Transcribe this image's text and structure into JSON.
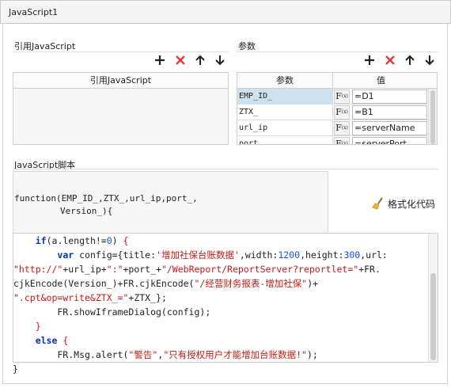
{
  "window": {
    "title": "JavaScript1"
  },
  "ref_section": {
    "label": "引用JavaScript",
    "column_header": "引用JavaScript",
    "rows": []
  },
  "params_section": {
    "label": "参数",
    "headers": {
      "name": "参数",
      "value": "值"
    },
    "rows": [
      {
        "name": "EMP_ID_",
        "value": "=D1",
        "selected": true
      },
      {
        "name": "ZTX_",
        "value": "=B1",
        "selected": false
      },
      {
        "name": "url_ip",
        "value": "=serverName",
        "selected": false
      },
      {
        "name": "port_",
        "value": "=serverPort",
        "selected": false
      }
    ],
    "formula_glyph": "F",
    "formula_sub": "(x)"
  },
  "toolbar": {
    "add_icon": "plus-icon",
    "delete_icon": "delete-x-icon",
    "up_icon": "arrow-up-icon",
    "down_icon": "arrow-down-icon",
    "delete_color": "#e53935"
  },
  "script_section": {
    "label": "JavaScript脚本",
    "signature_line1": "function(EMP_ID_,ZTX_,url_ip,port_,",
    "signature_line2": "Version_){",
    "format_button_label": "格式化代码",
    "closing_brace": "}"
  },
  "code": {
    "highlight_color": "#fbfbc8",
    "lines": [
      "    if(a.length!=0) {",
      "        var config={title:'增加社保台账数据',width:1200,height:300,url:",
      "\"http://\"+url_ip+\":\"+port_+\"/WebReport/ReportServer?reportlet=\"+FR.",
      "cjkEncode(Version_)+FR.cjkEncode(\"/经营财务报表-增加社保\")+",
      "\".cpt&op=write&ZTX_=\"+ZTX_};",
      "        FR.showIframeDialog(config);",
      "    }",
      "    else {",
      "        FR.Msg.alert(\"警告\",\"只有授权用户才能增加台账数据!\");",
      "    }"
    ]
  }
}
